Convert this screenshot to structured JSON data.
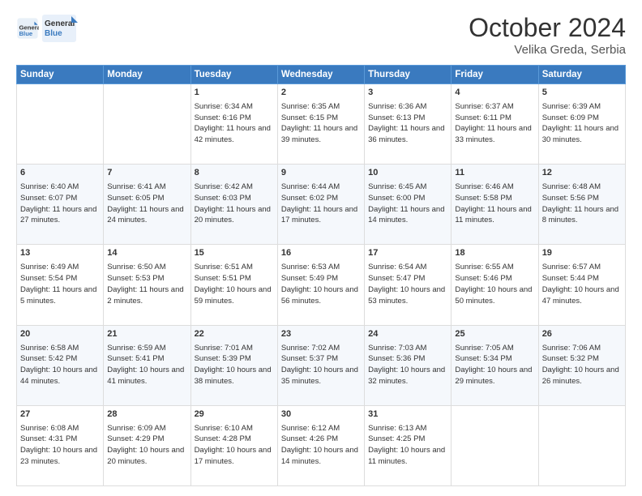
{
  "logo": {
    "line1": "General",
    "line2": "Blue"
  },
  "title": "October 2024",
  "location": "Velika Greda, Serbia",
  "days_of_week": [
    "Sunday",
    "Monday",
    "Tuesday",
    "Wednesday",
    "Thursday",
    "Friday",
    "Saturday"
  ],
  "weeks": [
    [
      {
        "day": "",
        "sunrise": "",
        "sunset": "",
        "daylight": ""
      },
      {
        "day": "",
        "sunrise": "",
        "sunset": "",
        "daylight": ""
      },
      {
        "day": "1",
        "sunrise": "Sunrise: 6:34 AM",
        "sunset": "Sunset: 6:16 PM",
        "daylight": "Daylight: 11 hours and 42 minutes."
      },
      {
        "day": "2",
        "sunrise": "Sunrise: 6:35 AM",
        "sunset": "Sunset: 6:15 PM",
        "daylight": "Daylight: 11 hours and 39 minutes."
      },
      {
        "day": "3",
        "sunrise": "Sunrise: 6:36 AM",
        "sunset": "Sunset: 6:13 PM",
        "daylight": "Daylight: 11 hours and 36 minutes."
      },
      {
        "day": "4",
        "sunrise": "Sunrise: 6:37 AM",
        "sunset": "Sunset: 6:11 PM",
        "daylight": "Daylight: 11 hours and 33 minutes."
      },
      {
        "day": "5",
        "sunrise": "Sunrise: 6:39 AM",
        "sunset": "Sunset: 6:09 PM",
        "daylight": "Daylight: 11 hours and 30 minutes."
      }
    ],
    [
      {
        "day": "6",
        "sunrise": "Sunrise: 6:40 AM",
        "sunset": "Sunset: 6:07 PM",
        "daylight": "Daylight: 11 hours and 27 minutes."
      },
      {
        "day": "7",
        "sunrise": "Sunrise: 6:41 AM",
        "sunset": "Sunset: 6:05 PM",
        "daylight": "Daylight: 11 hours and 24 minutes."
      },
      {
        "day": "8",
        "sunrise": "Sunrise: 6:42 AM",
        "sunset": "Sunset: 6:03 PM",
        "daylight": "Daylight: 11 hours and 20 minutes."
      },
      {
        "day": "9",
        "sunrise": "Sunrise: 6:44 AM",
        "sunset": "Sunset: 6:02 PM",
        "daylight": "Daylight: 11 hours and 17 minutes."
      },
      {
        "day": "10",
        "sunrise": "Sunrise: 6:45 AM",
        "sunset": "Sunset: 6:00 PM",
        "daylight": "Daylight: 11 hours and 14 minutes."
      },
      {
        "day": "11",
        "sunrise": "Sunrise: 6:46 AM",
        "sunset": "Sunset: 5:58 PM",
        "daylight": "Daylight: 11 hours and 11 minutes."
      },
      {
        "day": "12",
        "sunrise": "Sunrise: 6:48 AM",
        "sunset": "Sunset: 5:56 PM",
        "daylight": "Daylight: 11 hours and 8 minutes."
      }
    ],
    [
      {
        "day": "13",
        "sunrise": "Sunrise: 6:49 AM",
        "sunset": "Sunset: 5:54 PM",
        "daylight": "Daylight: 11 hours and 5 minutes."
      },
      {
        "day": "14",
        "sunrise": "Sunrise: 6:50 AM",
        "sunset": "Sunset: 5:53 PM",
        "daylight": "Daylight: 11 hours and 2 minutes."
      },
      {
        "day": "15",
        "sunrise": "Sunrise: 6:51 AM",
        "sunset": "Sunset: 5:51 PM",
        "daylight": "Daylight: 10 hours and 59 minutes."
      },
      {
        "day": "16",
        "sunrise": "Sunrise: 6:53 AM",
        "sunset": "Sunset: 5:49 PM",
        "daylight": "Daylight: 10 hours and 56 minutes."
      },
      {
        "day": "17",
        "sunrise": "Sunrise: 6:54 AM",
        "sunset": "Sunset: 5:47 PM",
        "daylight": "Daylight: 10 hours and 53 minutes."
      },
      {
        "day": "18",
        "sunrise": "Sunrise: 6:55 AM",
        "sunset": "Sunset: 5:46 PM",
        "daylight": "Daylight: 10 hours and 50 minutes."
      },
      {
        "day": "19",
        "sunrise": "Sunrise: 6:57 AM",
        "sunset": "Sunset: 5:44 PM",
        "daylight": "Daylight: 10 hours and 47 minutes."
      }
    ],
    [
      {
        "day": "20",
        "sunrise": "Sunrise: 6:58 AM",
        "sunset": "Sunset: 5:42 PM",
        "daylight": "Daylight: 10 hours and 44 minutes."
      },
      {
        "day": "21",
        "sunrise": "Sunrise: 6:59 AM",
        "sunset": "Sunset: 5:41 PM",
        "daylight": "Daylight: 10 hours and 41 minutes."
      },
      {
        "day": "22",
        "sunrise": "Sunrise: 7:01 AM",
        "sunset": "Sunset: 5:39 PM",
        "daylight": "Daylight: 10 hours and 38 minutes."
      },
      {
        "day": "23",
        "sunrise": "Sunrise: 7:02 AM",
        "sunset": "Sunset: 5:37 PM",
        "daylight": "Daylight: 10 hours and 35 minutes."
      },
      {
        "day": "24",
        "sunrise": "Sunrise: 7:03 AM",
        "sunset": "Sunset: 5:36 PM",
        "daylight": "Daylight: 10 hours and 32 minutes."
      },
      {
        "day": "25",
        "sunrise": "Sunrise: 7:05 AM",
        "sunset": "Sunset: 5:34 PM",
        "daylight": "Daylight: 10 hours and 29 minutes."
      },
      {
        "day": "26",
        "sunrise": "Sunrise: 7:06 AM",
        "sunset": "Sunset: 5:32 PM",
        "daylight": "Daylight: 10 hours and 26 minutes."
      }
    ],
    [
      {
        "day": "27",
        "sunrise": "Sunrise: 6:08 AM",
        "sunset": "Sunset: 4:31 PM",
        "daylight": "Daylight: 10 hours and 23 minutes."
      },
      {
        "day": "28",
        "sunrise": "Sunrise: 6:09 AM",
        "sunset": "Sunset: 4:29 PM",
        "daylight": "Daylight: 10 hours and 20 minutes."
      },
      {
        "day": "29",
        "sunrise": "Sunrise: 6:10 AM",
        "sunset": "Sunset: 4:28 PM",
        "daylight": "Daylight: 10 hours and 17 minutes."
      },
      {
        "day": "30",
        "sunrise": "Sunrise: 6:12 AM",
        "sunset": "Sunset: 4:26 PM",
        "daylight": "Daylight: 10 hours and 14 minutes."
      },
      {
        "day": "31",
        "sunrise": "Sunrise: 6:13 AM",
        "sunset": "Sunset: 4:25 PM",
        "daylight": "Daylight: 10 hours and 11 minutes."
      },
      {
        "day": "",
        "sunrise": "",
        "sunset": "",
        "daylight": ""
      },
      {
        "day": "",
        "sunrise": "",
        "sunset": "",
        "daylight": ""
      }
    ]
  ]
}
